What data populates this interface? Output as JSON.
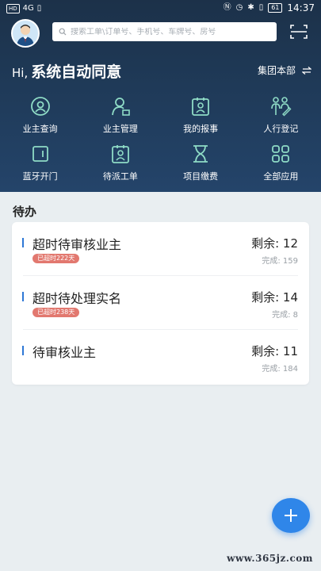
{
  "status_bar": {
    "hd_label": "HD",
    "network_label": "4G",
    "battery": "61",
    "time": "14:37"
  },
  "header": {
    "search_placeholder": "搜索工单\\订单号、手机号、车牌号、房号",
    "greeting_hi": "Hi,",
    "greeting_name": "系统自动同意",
    "org_name": "集团本部",
    "icons": [
      "avatar",
      "search-icon",
      "scan-icon",
      "swap-icon"
    ]
  },
  "menu": {
    "items": [
      {
        "label": "业主查询",
        "icon": "owner-search-icon"
      },
      {
        "label": "业主管理",
        "icon": "owner-manage-icon"
      },
      {
        "label": "我的报事",
        "icon": "my-report-icon"
      },
      {
        "label": "人行登记",
        "icon": "pedestrian-register-icon"
      },
      {
        "label": "蓝牙开门",
        "icon": "bluetooth-door-icon"
      },
      {
        "label": "待派工单",
        "icon": "pending-dispatch-icon"
      },
      {
        "label": "项目缴费",
        "icon": "project-payment-icon"
      },
      {
        "label": "全部应用",
        "icon": "all-apps-icon"
      }
    ]
  },
  "todo": {
    "title": "待办",
    "tasks": [
      {
        "title": "超时待审核业主",
        "badge": "已超时222天",
        "remain": "剩余: 12",
        "done": "完成: 159"
      },
      {
        "title": "超时待处理实名",
        "badge": "已超时238天",
        "remain": "剩余: 14",
        "done": "完成: 8"
      },
      {
        "title": "待审核业主",
        "badge": "",
        "remain": "剩余: 11",
        "done": "完成: 184"
      }
    ]
  },
  "watermark": "www.365jz.com",
  "colors": {
    "header_dark": "#1c3149",
    "accent_blue": "#2f86e9",
    "badge_red": "#e2786f",
    "icon_mint": "#8fdcc6"
  }
}
